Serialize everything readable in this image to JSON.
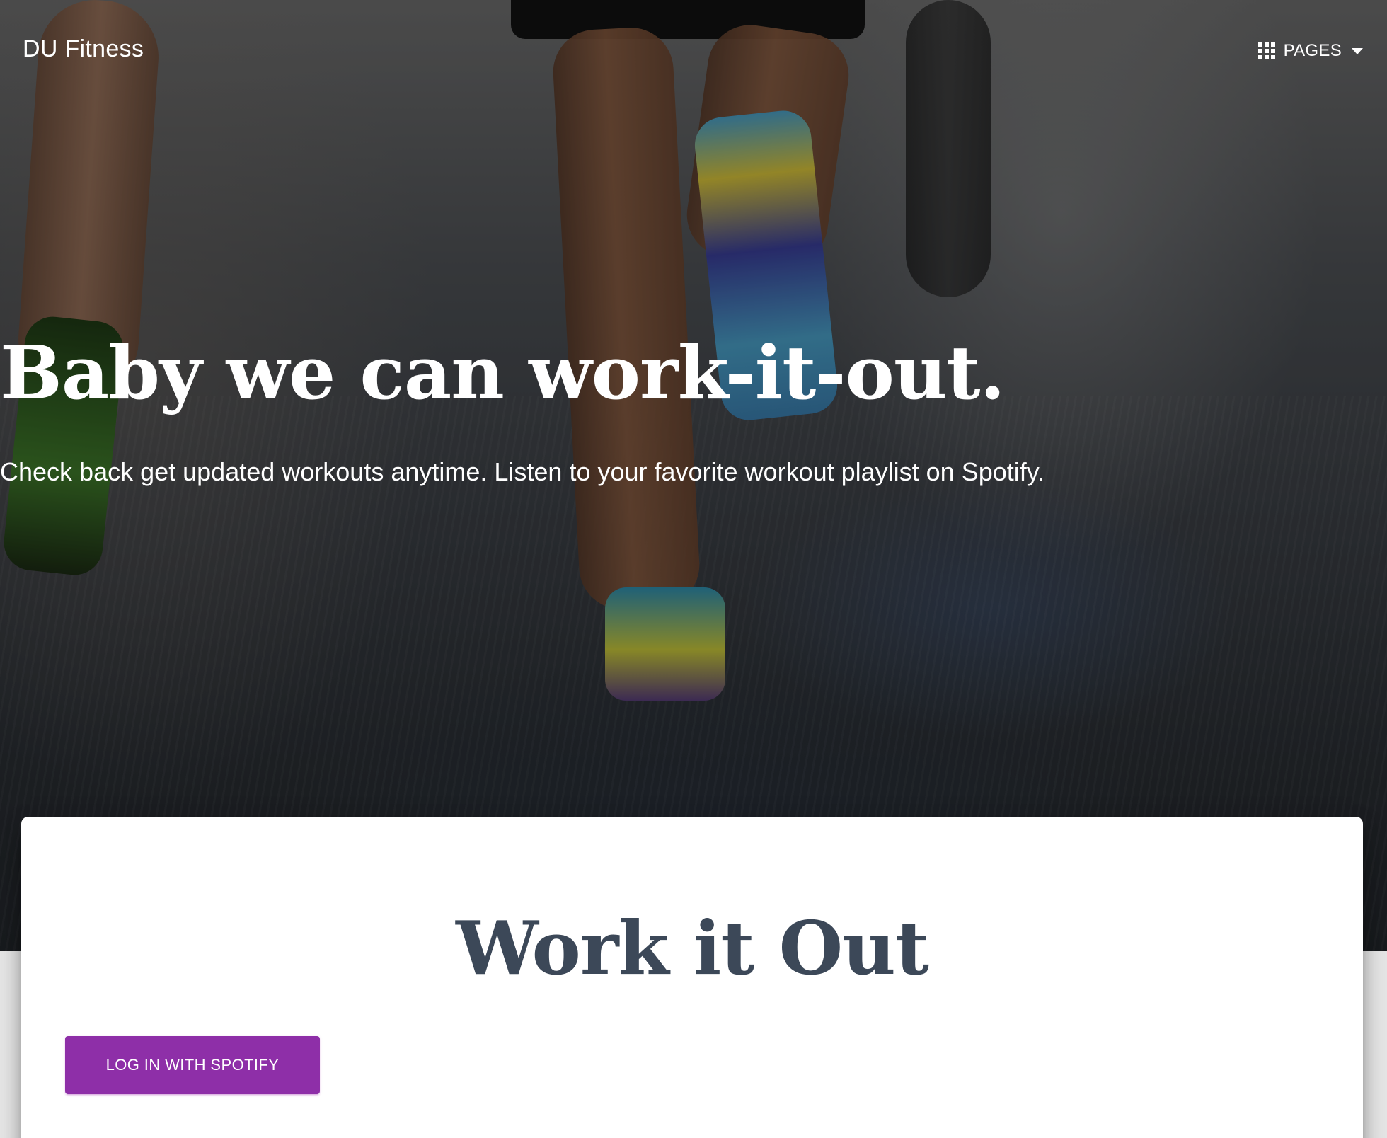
{
  "navbar": {
    "brand": "DU Fitness",
    "pages_label": "PAGES",
    "pages_icon": "apps-grid-icon",
    "caret_icon": "caret-down-icon"
  },
  "hero": {
    "title": "Baby we can work-it-out.",
    "subtitle": "Check back get updated workouts anytime. Listen to your favorite workout playlist on Spotify."
  },
  "card": {
    "title": "Work it Out",
    "spotify_button_label": "LOG IN WITH SPOTIFY"
  },
  "colors": {
    "button_purple": "#8e2fa8",
    "card_title": "#3c4858",
    "page_background": "#e5e5e5"
  }
}
